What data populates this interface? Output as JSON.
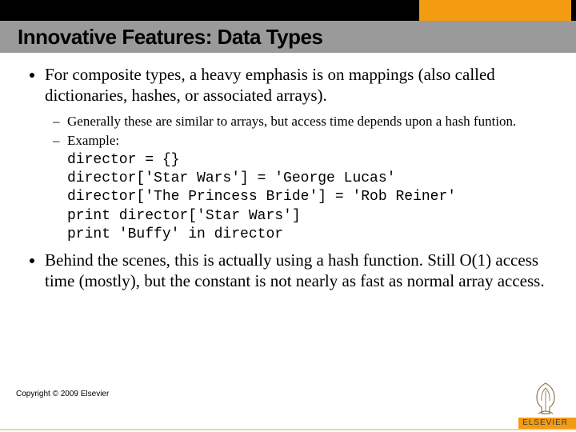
{
  "title": "Innovative Features: Data Types",
  "bullets": [
    {
      "text": "For composite types, a heavy emphasis is on mappings (also called dictionaries, hashes, or associated arrays).",
      "sub": [
        "Generally these are similar to arrays, but access time depends upon a hash funtion.",
        "Example:"
      ],
      "code": "director = {}\ndirector['Star Wars'] = 'George Lucas'\ndirector['The Princess Bride'] = 'Rob Reiner'\nprint director['Star Wars']\nprint 'Buffy' in director"
    },
    {
      "text": "Behind the scenes, this is actually using a hash function.  Still O(1) access time (mostly), but the constant is not nearly as fast as normal array access."
    }
  ],
  "copyright": "Copyright © 2009 Elsevier",
  "logo_text": "ELSEVIER"
}
